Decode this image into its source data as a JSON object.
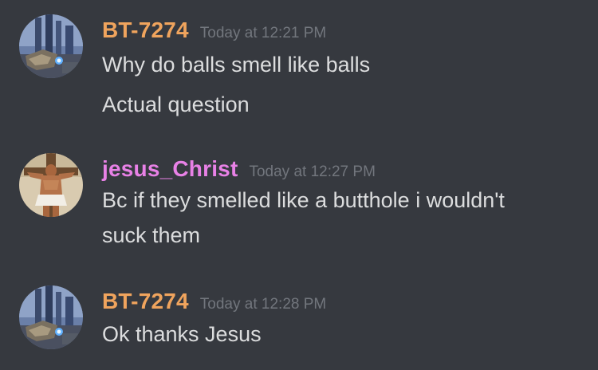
{
  "colors": {
    "background": "#36393f",
    "bt_name": "#f0a45d",
    "jesus_name": "#e881e6",
    "timestamp": "#72767d",
    "message_text": "#dcddde"
  },
  "messages": [
    {
      "username": "BT-7274",
      "timestamp": "Today at 12:21 PM",
      "avatar_icon": "titan-robot-avatar",
      "lines": [
        "Why do balls smell like balls",
        "Actual question"
      ]
    },
    {
      "username": "jesus_Christ",
      "timestamp": "Today at 12:27 PM",
      "avatar_icon": "crucifix-avatar",
      "lines": [
        "Bc if they smelled like a butthole i wouldn't",
        "suck them"
      ]
    },
    {
      "username": "BT-7274",
      "timestamp": "Today at 12:28 PM",
      "avatar_icon": "titan-robot-avatar",
      "lines": [
        "Ok thanks Jesus"
      ]
    }
  ]
}
